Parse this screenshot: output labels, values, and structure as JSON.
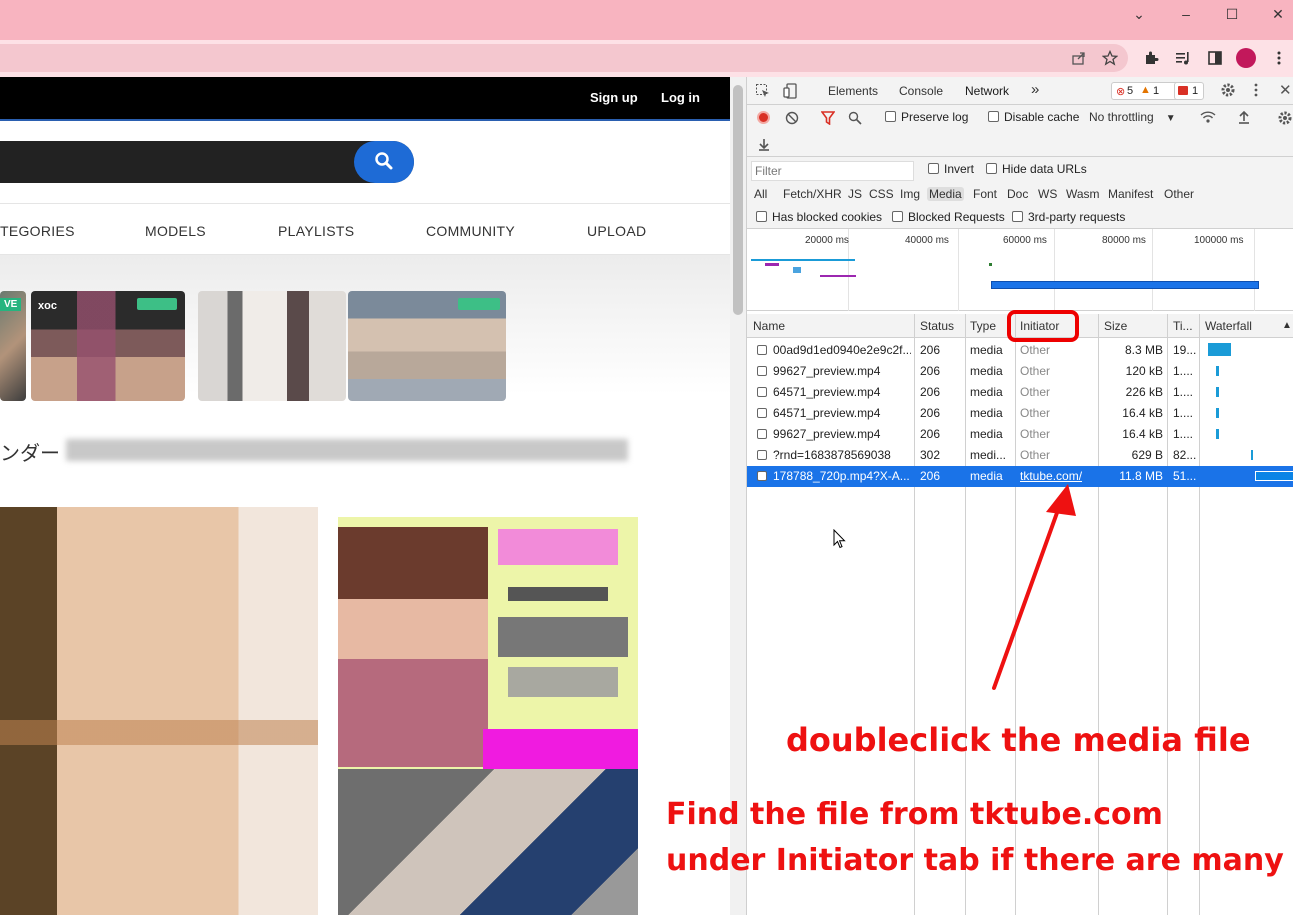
{
  "browser": {
    "window_controls": [
      "⌄",
      "–",
      "☐",
      "✕"
    ]
  },
  "site": {
    "nav": {
      "signup": "Sign up",
      "login": "Log in"
    },
    "categories": [
      "TEGORIES",
      "MODELS",
      "PLAYLISTS",
      "COMMUNITY",
      "UPLOAD"
    ],
    "live_badge": "VE",
    "thumb_label": "xoc",
    "heading_jp": "ンダー"
  },
  "devtools": {
    "tabs": [
      "Elements",
      "Console",
      "Network"
    ],
    "active_tab": "Network",
    "more": "»",
    "errors": "5",
    "warnings": "1",
    "issues": "1",
    "toolbar": {
      "preserve_log": "Preserve log",
      "disable_cache": "Disable cache",
      "throttling": "No throttling"
    },
    "filter": {
      "placeholder": "Filter",
      "invert": "Invert",
      "hide_data_urls": "Hide data URLs",
      "types": [
        "All",
        "Fetch/XHR",
        "JS",
        "CSS",
        "Img",
        "Media",
        "Font",
        "Doc",
        "WS",
        "Wasm",
        "Manifest",
        "Other"
      ],
      "active_type": "Media",
      "has_blocked_cookies": "Has blocked cookies",
      "blocked_requests": "Blocked Requests",
      "third_party": "3rd-party requests"
    },
    "overview_ticks": [
      "20000 ms",
      "40000 ms",
      "60000 ms",
      "80000 ms",
      "100000 ms"
    ],
    "columns": [
      "Name",
      "Status",
      "Type",
      "Initiator",
      "Size",
      "Ti...",
      "Waterfall"
    ],
    "rows": [
      {
        "name": "00ad9d1ed0940e2e9c2f...",
        "status": "206",
        "type": "media",
        "initiator": "Other",
        "size": "8.3 MB",
        "time": "19..."
      },
      {
        "name": "99627_preview.mp4",
        "status": "206",
        "type": "media",
        "initiator": "Other",
        "size": "120 kB",
        "time": "1...."
      },
      {
        "name": "64571_preview.mp4",
        "status": "206",
        "type": "media",
        "initiator": "Other",
        "size": "226 kB",
        "time": "1...."
      },
      {
        "name": "64571_preview.mp4",
        "status": "206",
        "type": "media",
        "initiator": "Other",
        "size": "16.4 kB",
        "time": "1...."
      },
      {
        "name": "99627_preview.mp4",
        "status": "206",
        "type": "media",
        "initiator": "Other",
        "size": "16.4 kB",
        "time": "1...."
      },
      {
        "name": "?rnd=1683878569038",
        "status": "302",
        "type": "medi...",
        "initiator": "Other",
        "size": "629 B",
        "time": "82..."
      },
      {
        "name": "178788_720p.mp4?X-A...",
        "status": "206",
        "type": "media",
        "initiator": "tktube.com/",
        "size": "11.8 MB",
        "time": "51..."
      }
    ]
  },
  "annotations": {
    "double_click": "doubleclick  the media file",
    "find_line1": "Find the file from tktube.com",
    "find_line2": "under Initiator tab if there are many"
  },
  "colors": {
    "titlebar": "#f8b4c0",
    "selection": "#1a73e8",
    "annotation": "#ee1111"
  }
}
